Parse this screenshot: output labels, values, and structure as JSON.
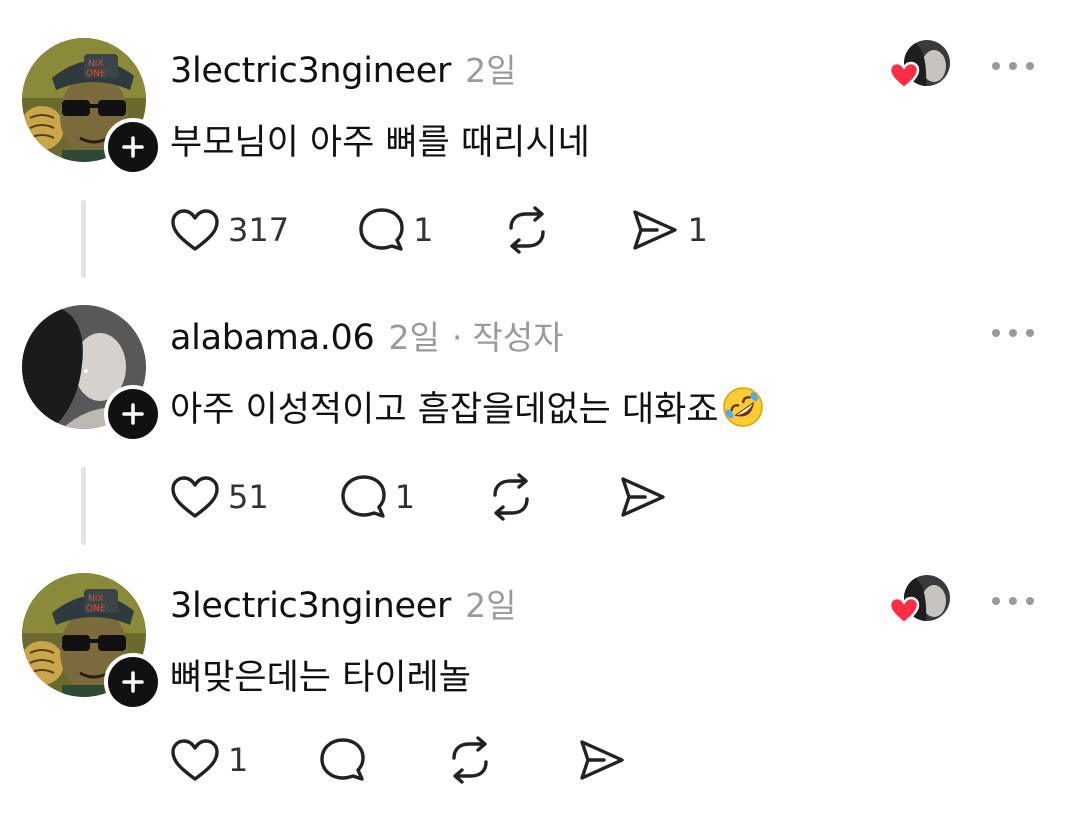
{
  "comments": [
    {
      "username": "3lectric3ngineer",
      "time": "2일",
      "text": "부모님이 아주 뼈를 때리시네",
      "likes": "317",
      "replies": "1",
      "reposts": "",
      "shares": "1",
      "liked_by_author": true,
      "has_thread_line": true
    },
    {
      "username": "alabama.06",
      "time": "2일",
      "author_dot": "·",
      "author_tag": "작성자",
      "text": "아주 이성적이고 흠잡을데없는 대화죠",
      "likes": "51",
      "replies": "1",
      "reposts": "",
      "shares": "",
      "has_thread_line": true
    },
    {
      "username": "3lectric3ngineer",
      "time": "2일",
      "text": "뼈맞은데는 타이레놀",
      "likes": "1",
      "replies": "",
      "reposts": "",
      "shares": "",
      "liked_by_author": true,
      "has_thread_line": false
    }
  ],
  "icons": {
    "like": "heart-outline-icon",
    "reply": "speech-bubble-icon",
    "repost": "repost-arrows-icon",
    "share": "send-paper-plane-icon",
    "more": "more-dots-icon",
    "follow": "plus-icon",
    "emoji": "rolling-on-floor-laughing-emoji"
  },
  "colors": {
    "text": "#111111",
    "muted": "#9a9a9a",
    "heart_red": "#ff2d45",
    "thread_line": "#e3e3e3"
  }
}
